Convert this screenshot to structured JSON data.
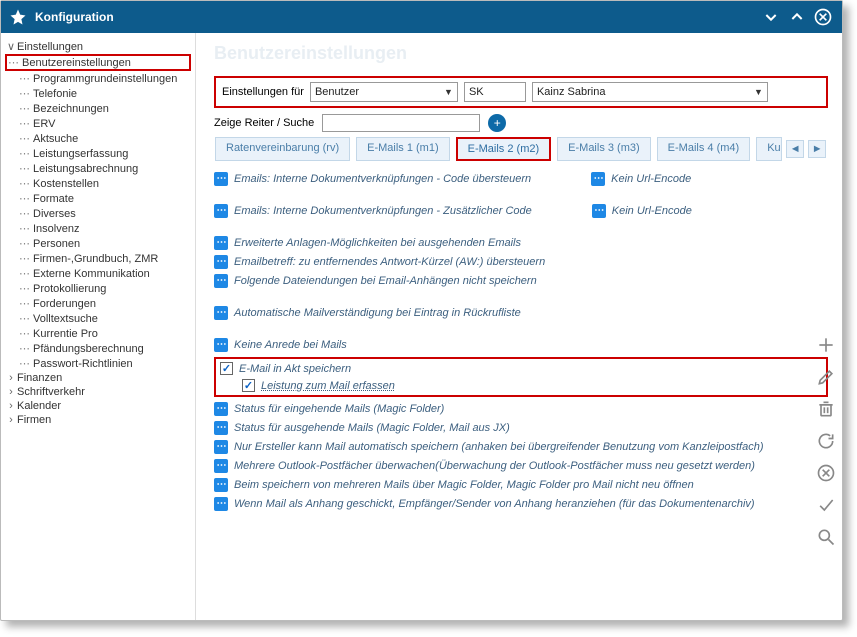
{
  "titlebar": {
    "title": "Konfiguration"
  },
  "sidebar": {
    "root": "Einstellungen",
    "highlighted": "Benutzereinstellungen",
    "items": [
      "Programmgrundeinstellungen",
      "Telefonie",
      "Bezeichnungen",
      "ERV",
      "Aktsuche",
      "Leistungserfassung",
      "Leistungsabrechnung",
      "Kostenstellen",
      "Formate",
      "Diverses",
      "Insolvenz",
      "Personen",
      "Firmen-,Grundbuch, ZMR",
      "Externe Kommunikation",
      "Protokollierung",
      "Forderungen",
      "Volltextsuche",
      "Kurrentie Pro",
      "Pfändungsberechnung",
      "Passwort-Richtlinien"
    ],
    "collapsed": [
      "Finanzen",
      "Schriftverkehr",
      "Kalender",
      "Firmen"
    ]
  },
  "main": {
    "title": "Benutzereinstellungen",
    "filters": {
      "label": "Einstellungen für",
      "sel1": "Benutzer",
      "code": "SK",
      "user": "Kainz Sabrina"
    },
    "search": {
      "label": "Zeige Reiter / Suche",
      "value": ""
    },
    "tabs": [
      "Ratenvereinbarung (rv)",
      "E-Mails 1 (m1)",
      "E-Mails 2 (m2)",
      "E-Mails 3 (m3)",
      "E-Mails 4 (m4)",
      "Kur"
    ],
    "activeTab": 2,
    "settings": {
      "pair1a": "Emails: Interne Dokumentverknüpfungen - Code übersteuern",
      "pair1b": "Kein Url-Encode",
      "pair2a": "Emails: Interne Dokumentverknüpfungen - Zusätzlicher Code",
      "pair2b": "Kein Url-Encode",
      "l3": "Erweiterte Anlagen-Möglichkeiten bei ausgehenden Emails",
      "l4": "Emailbetreff: zu entfernendes Antwort-Kürzel (AW:) übersteuern",
      "l5": "Folgende Dateiendungen bei Email-Anhängen nicht speichern",
      "l6": "Automatische Mailverständigung bei Eintrag in Rückrufliste",
      "l7": "Keine Anrede bei Mails",
      "chk1": "E-Mail in Akt speichern",
      "chk2": "Leistung zum Mail erfassen",
      "l8": "Status für eingehende Mails (Magic Folder)",
      "l9": "Status für ausgehende Mails (Magic Folder, Mail aus JX)",
      "l10": "Nur Ersteller kann Mail automatisch speichern (anhaken bei übergreifender Benutzung vom Kanzleipostfach)",
      "l11": "Mehrere Outlook-Postfächer überwachen(Überwachung der Outlook-Postfächer muss neu gesetzt werden)",
      "l12": "Beim speichern von mehreren Mails über Magic Folder, Magic Folder pro Mail nicht neu öffnen",
      "l13": "Wenn Mail als Anhang geschickt, Empfänger/Sender von Anhang heranziehen (für das Dokumentenarchiv)"
    }
  }
}
